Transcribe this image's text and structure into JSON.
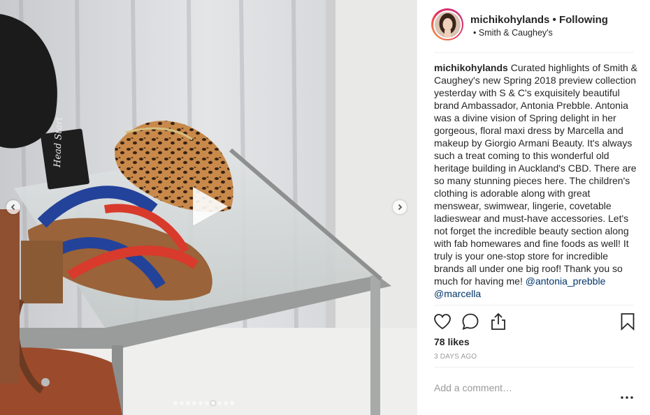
{
  "post": {
    "username": "michikohylands",
    "separator": "•",
    "follow_label": "Following",
    "location_bullet": "•",
    "location": "Smith & Caughey's"
  },
  "caption": {
    "username": "michikohylands",
    "text": "Curated highlights of Smith & Caughey's new Spring 2018 preview collection yesterday with S & C's exquisitely beautiful brand Ambassador, Antonia Prebble. Antonia was a divine vision of Spring delight in her gorgeous, floral maxi dress by Marcella and makeup by Giorgio Armani Beauty. It's always such a treat coming to this wonderful old heritage building in Auckland's CBD. There are so many stunning pieces here. The children's clothing is adorable along with great menswear, swimwear, lingerie, covetable ladieswear and must-have accessories. Let's not forget the incredible beauty section along with fab homewares and fine foods as well! It truly is your one-stop store for incredible brands all under one big roof! Thank you so much for having me!",
    "tags": "@antonia_prebble @marcella"
  },
  "media": {
    "tag_text": "Head Start",
    "carousel_count": 10,
    "carousel_active": 6
  },
  "actions": {
    "like_icon": "heart-icon",
    "comment_icon": "comment-icon",
    "share_icon": "share-icon",
    "save_icon": "bookmark-icon"
  },
  "likes": "78 likes",
  "timestamp": "3 DAYS AGO",
  "comment_placeholder": "Add a comment…",
  "more_icon": "more-options-icon"
}
